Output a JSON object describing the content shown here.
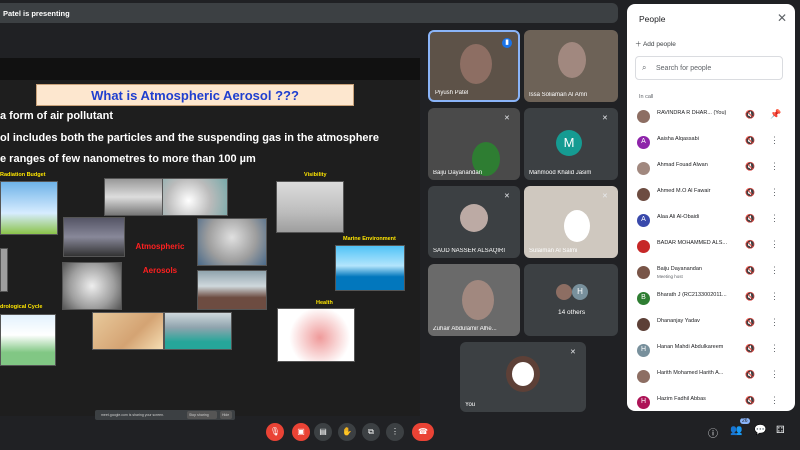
{
  "presenting": "Patel is presenting",
  "slide": {
    "title": "What is Atmospheric Aerosol ???",
    "bullets": [
      "a form of air pollutant",
      "ol includes both the particles and the suspending gas in the atmosphere",
      "e ranges of few nanometres to more than 100 µm"
    ],
    "labels": {
      "radiation": "Radiation Budget",
      "visibility": "Visibility",
      "marine": "Marine Environment",
      "hydro": "drological Cycle",
      "health": "Health",
      "center_line1": "Atmospheric",
      "center_line2": "Aerosols"
    },
    "share_text": "meet.google.com is sharing your screen.",
    "stop_sharing": "Stop sharing",
    "hide": "Hide"
  },
  "tiles": [
    {
      "name": "Piyush Patel"
    },
    {
      "name": "Issa Soliaman Al Amri"
    },
    {
      "name": "Baiju Dayanandan"
    },
    {
      "name": "Mahmood Khalid Jasim",
      "initial": "M"
    },
    {
      "name": "SAUD NASSER ALSAQIRI"
    },
    {
      "name": "Sulaiman Al Salmi"
    },
    {
      "name": "Zuhair Abdulamir Alhe..."
    },
    {
      "name": "14 others",
      "initial": "H"
    },
    {
      "name": "You"
    }
  ],
  "people_panel": {
    "title": "People",
    "add_people": "Add people",
    "search_placeholder": "Search for people",
    "in_call": "In call",
    "people": [
      {
        "name": "RAVINDRA R DHAR...",
        "note": "(You)",
        "initial": "",
        "color": "#8d6e63"
      },
      {
        "name": "Aaisha Alqassabi",
        "initial": "A",
        "color": "#8e24aa"
      },
      {
        "name": "Ahmad Fouad Alwan",
        "initial": "",
        "color": "#a1887f"
      },
      {
        "name": "Ahmed M.O Al Fawair",
        "initial": "",
        "color": "#6d4c41"
      },
      {
        "name": "Alaa Ali Al-Obaidi",
        "initial": "A",
        "color": "#3949ab"
      },
      {
        "name": "BADAR MOHAMMED ALS...",
        "initial": "",
        "color": "#c62828"
      },
      {
        "name": "Baiju Dayanandan",
        "sub": "Meeting host",
        "initial": "",
        "color": "#795548"
      },
      {
        "name": "Bharath J (RC2133002011...",
        "initial": "B",
        "color": "#2e7d32"
      },
      {
        "name": "Dhananjay Yadav",
        "initial": "",
        "color": "#5d4037"
      },
      {
        "name": "Hanan Mahdi Abdulkareem",
        "initial": "H",
        "color": "#78909c"
      },
      {
        "name": "Harith Mohamed Harith A...",
        "initial": "",
        "color": "#8d6e63"
      },
      {
        "name": "Hazim Fadhil Abbas",
        "initial": "H",
        "color": "#ad1457"
      }
    ]
  },
  "participant_count": "26",
  "colors": {
    "accent_red": "#ea4335",
    "tile_bg": "#3c4043",
    "bg": "#202124"
  }
}
